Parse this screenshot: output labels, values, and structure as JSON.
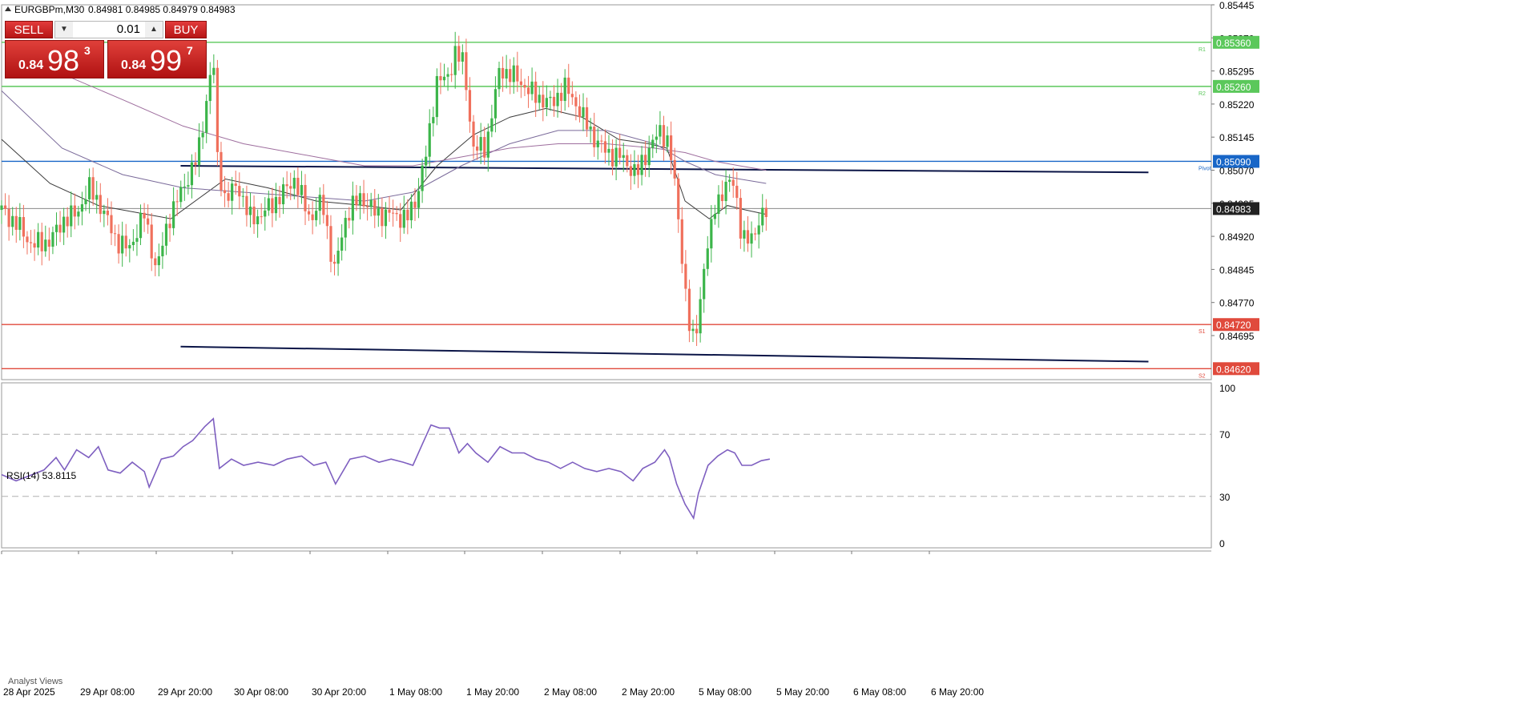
{
  "header": {
    "symbol": "EURGBPm,M30",
    "ohlc": "0.84981 0.84985 0.84979 0.84983"
  },
  "trade_panel": {
    "sell_label": "SELL",
    "buy_label": "BUY",
    "lot": "0.01",
    "sell_price_prefix": "0.84",
    "sell_price_big": "98",
    "sell_price_sup": "3",
    "buy_price_prefix": "0.84",
    "buy_price_big": "99",
    "buy_price_sup": "7"
  },
  "rsi": {
    "label": "RSI(14) 53.8115",
    "y_ticks": [
      "100",
      "70",
      "30",
      "0"
    ]
  },
  "footer": {
    "analyst": "Analyst Views"
  },
  "colors": {
    "bull": "#3cb54a",
    "bear": "#f0705c",
    "resistance": "#5bc85b",
    "support": "#e04a3c",
    "pivot": "#1866c7",
    "current": "#333333",
    "rsi_line": "#7e5fc0",
    "trend": "#0b1547"
  },
  "chart_data": [
    {
      "type": "candlestick",
      "symbol": "EURGBPm",
      "timeframe": "M30",
      "y_ticks": [
        "0.85445",
        "0.85370",
        "0.85295",
        "0.85220",
        "0.85145",
        "0.85070",
        "0.84995",
        "0.84920",
        "0.84845",
        "0.84770",
        "0.84695"
      ],
      "ylim": [
        0.8462,
        0.8544
      ],
      "x_ticks": [
        "28 Apr 2025",
        "29 Apr 08:00",
        "29 Apr 20:00",
        "30 Apr 08:00",
        "30 Apr 20:00",
        "1 May 08:00",
        "1 May 20:00",
        "2 May 08:00",
        "2 May 20:00",
        "5 May 08:00",
        "5 May 20:00",
        "6 May 08:00",
        "6 May 20:00"
      ],
      "levels": [
        {
          "label": "R1",
          "price_label": "0.85360",
          "value": 0.8536,
          "kind": "resistance"
        },
        {
          "label": "R2",
          "price_label": "0.85260",
          "value": 0.8526,
          "kind": "resistance"
        },
        {
          "label": "Pivot",
          "price_label": "0.85090",
          "value": 0.8509,
          "kind": "pivot"
        },
        {
          "label": "S1",
          "price_label": "0.84720",
          "value": 0.8472,
          "kind": "support"
        },
        {
          "label": "S2",
          "price_label": "0.84620",
          "value": 0.8462,
          "kind": "support"
        }
      ],
      "current_price": {
        "price_label": "0.84983",
        "value": 0.84983
      },
      "trend_lines": [
        [
          [
            0.148,
            0.8508
          ],
          [
            0.948,
            0.85065
          ]
        ],
        [
          [
            0.148,
            0.8467
          ],
          [
            0.948,
            0.84636
          ]
        ]
      ],
      "close_anchors": [
        [
          0.0,
          0.8498
        ],
        [
          0.015,
          0.8494
        ],
        [
          0.025,
          0.849
        ],
        [
          0.04,
          0.8491
        ],
        [
          0.052,
          0.8496
        ],
        [
          0.062,
          0.8497
        ],
        [
          0.072,
          0.8503
        ],
        [
          0.08,
          0.85
        ],
        [
          0.095,
          0.8491
        ],
        [
          0.105,
          0.8489
        ],
        [
          0.118,
          0.8497
        ],
        [
          0.128,
          0.8484
        ],
        [
          0.138,
          0.8496
        ],
        [
          0.15,
          0.8503
        ],
        [
          0.162,
          0.851
        ],
        [
          0.17,
          0.8524
        ],
        [
          0.175,
          0.8533
        ],
        [
          0.178,
          0.851
        ],
        [
          0.185,
          0.85
        ],
        [
          0.195,
          0.8504
        ],
        [
          0.205,
          0.8496
        ],
        [
          0.215,
          0.8497
        ],
        [
          0.23,
          0.8501
        ],
        [
          0.242,
          0.8505
        ],
        [
          0.255,
          0.8496
        ],
        [
          0.265,
          0.85
        ],
        [
          0.275,
          0.8484
        ],
        [
          0.285,
          0.8497
        ],
        [
          0.297,
          0.8501
        ],
        [
          0.31,
          0.8497
        ],
        [
          0.322,
          0.8497
        ],
        [
          0.335,
          0.8496
        ],
        [
          0.342,
          0.85
        ],
        [
          0.352,
          0.8512
        ],
        [
          0.36,
          0.8528
        ],
        [
          0.368,
          0.8527
        ],
        [
          0.375,
          0.8534
        ],
        [
          0.382,
          0.8531
        ],
        [
          0.39,
          0.8512
        ],
        [
          0.4,
          0.8512
        ],
        [
          0.412,
          0.853
        ],
        [
          0.425,
          0.8528
        ],
        [
          0.44,
          0.8524
        ],
        [
          0.455,
          0.8522
        ],
        [
          0.465,
          0.8526
        ],
        [
          0.475,
          0.8522
        ],
        [
          0.488,
          0.8515
        ],
        [
          0.5,
          0.8511
        ],
        [
          0.512,
          0.851
        ],
        [
          0.525,
          0.8506
        ],
        [
          0.535,
          0.8512
        ],
        [
          0.545,
          0.8516
        ],
        [
          0.552,
          0.8513
        ],
        [
          0.558,
          0.85
        ],
        [
          0.563,
          0.8486
        ],
        [
          0.568,
          0.8472
        ],
        [
          0.572,
          0.8468
        ],
        [
          0.576,
          0.8474
        ],
        [
          0.58,
          0.8484
        ],
        [
          0.585,
          0.8491
        ],
        [
          0.59,
          0.85
        ],
        [
          0.598,
          0.8502
        ],
        [
          0.604,
          0.8506
        ],
        [
          0.608,
          0.85
        ],
        [
          0.612,
          0.849
        ],
        [
          0.618,
          0.8492
        ],
        [
          0.625,
          0.8494
        ],
        [
          0.632,
          0.8498
        ]
      ],
      "ma_lines": [
        {
          "color": "#3a3a3a",
          "points": [
            [
              0.0,
              0.8514
            ],
            [
              0.04,
              0.8504
            ],
            [
              0.08,
              0.8499
            ],
            [
              0.12,
              0.8497
            ],
            [
              0.14,
              0.8496
            ],
            [
              0.165,
              0.8501
            ],
            [
              0.185,
              0.8505
            ],
            [
              0.22,
              0.8503
            ],
            [
              0.26,
              0.85
            ],
            [
              0.3,
              0.8499
            ],
            [
              0.33,
              0.8498
            ],
            [
              0.36,
              0.8508
            ],
            [
              0.39,
              0.8515
            ],
            [
              0.42,
              0.8519
            ],
            [
              0.45,
              0.8521
            ],
            [
              0.48,
              0.8519
            ],
            [
              0.51,
              0.8514
            ],
            [
              0.535,
              0.8513
            ],
            [
              0.55,
              0.8512
            ],
            [
              0.565,
              0.85
            ],
            [
              0.585,
              0.8496
            ],
            [
              0.6,
              0.8499
            ],
            [
              0.615,
              0.8498
            ],
            [
              0.632,
              0.8497
            ]
          ]
        },
        {
          "color": "#7a6a9a",
          "points": [
            [
              0.0,
              0.8525
            ],
            [
              0.05,
              0.8512
            ],
            [
              0.1,
              0.8506
            ],
            [
              0.15,
              0.8503
            ],
            [
              0.2,
              0.8502
            ],
            [
              0.25,
              0.8501
            ],
            [
              0.3,
              0.85
            ],
            [
              0.34,
              0.8502
            ],
            [
              0.38,
              0.8508
            ],
            [
              0.42,
              0.8513
            ],
            [
              0.46,
              0.8516
            ],
            [
              0.5,
              0.8516
            ],
            [
              0.54,
              0.8513
            ],
            [
              0.565,
              0.8509
            ],
            [
              0.59,
              0.8506
            ],
            [
              0.61,
              0.8505
            ],
            [
              0.632,
              0.8504
            ]
          ]
        },
        {
          "color": "#9e6e9e",
          "points": [
            [
              0.04,
              0.853
            ],
            [
              0.1,
              0.8523
            ],
            [
              0.15,
              0.8517
            ],
            [
              0.2,
              0.8513
            ],
            [
              0.26,
              0.851
            ],
            [
              0.3,
              0.8508
            ],
            [
              0.34,
              0.8508
            ],
            [
              0.38,
              0.851
            ],
            [
              0.42,
              0.8512
            ],
            [
              0.46,
              0.8513
            ],
            [
              0.5,
              0.8513
            ],
            [
              0.54,
              0.8512
            ],
            [
              0.565,
              0.8511
            ],
            [
              0.59,
              0.8509
            ],
            [
              0.61,
              0.8508
            ],
            [
              0.632,
              0.8507
            ]
          ]
        }
      ]
    },
    {
      "type": "line",
      "name": "RSI(14)",
      "ylim": [
        0,
        100
      ],
      "levels": [
        70,
        30
      ],
      "points": [
        [
          0.0,
          44
        ],
        [
          0.012,
          40
        ],
        [
          0.022,
          43
        ],
        [
          0.035,
          47
        ],
        [
          0.045,
          55
        ],
        [
          0.052,
          47
        ],
        [
          0.062,
          60
        ],
        [
          0.072,
          55
        ],
        [
          0.08,
          62
        ],
        [
          0.088,
          47
        ],
        [
          0.098,
          45
        ],
        [
          0.108,
          52
        ],
        [
          0.118,
          46
        ],
        [
          0.122,
          36
        ],
        [
          0.132,
          54
        ],
        [
          0.142,
          56
        ],
        [
          0.15,
          62
        ],
        [
          0.158,
          66
        ],
        [
          0.168,
          75
        ],
        [
          0.175,
          80
        ],
        [
          0.18,
          48
        ],
        [
          0.19,
          54
        ],
        [
          0.2,
          50
        ],
        [
          0.212,
          52
        ],
        [
          0.225,
          50
        ],
        [
          0.236,
          54
        ],
        [
          0.248,
          56
        ],
        [
          0.258,
          50
        ],
        [
          0.268,
          52
        ],
        [
          0.276,
          38
        ],
        [
          0.288,
          54
        ],
        [
          0.3,
          56
        ],
        [
          0.312,
          52
        ],
        [
          0.322,
          54
        ],
        [
          0.332,
          52
        ],
        [
          0.34,
          50
        ],
        [
          0.348,
          64
        ],
        [
          0.355,
          76
        ],
        [
          0.362,
          74
        ],
        [
          0.37,
          74
        ],
        [
          0.378,
          58
        ],
        [
          0.385,
          64
        ],
        [
          0.392,
          58
        ],
        [
          0.402,
          52
        ],
        [
          0.412,
          62
        ],
        [
          0.422,
          58
        ],
        [
          0.432,
          58
        ],
        [
          0.442,
          54
        ],
        [
          0.452,
          52
        ],
        [
          0.462,
          48
        ],
        [
          0.472,
          52
        ],
        [
          0.482,
          48
        ],
        [
          0.492,
          46
        ],
        [
          0.502,
          48
        ],
        [
          0.512,
          46
        ],
        [
          0.522,
          40
        ],
        [
          0.53,
          48
        ],
        [
          0.54,
          52
        ],
        [
          0.548,
          60
        ],
        [
          0.552,
          55
        ],
        [
          0.558,
          38
        ],
        [
          0.565,
          25
        ],
        [
          0.572,
          16
        ],
        [
          0.576,
          32
        ],
        [
          0.584,
          50
        ],
        [
          0.592,
          56
        ],
        [
          0.6,
          60
        ],
        [
          0.606,
          58
        ],
        [
          0.612,
          50
        ],
        [
          0.62,
          50
        ],
        [
          0.628,
          53
        ],
        [
          0.635,
          54
        ]
      ]
    }
  ]
}
